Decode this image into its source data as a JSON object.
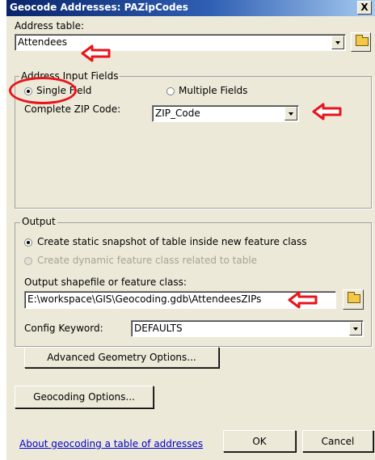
{
  "title": "Geocode Addresses: PAZipCodes",
  "close_label": "X",
  "address_table": {
    "label": "Address table:",
    "value": "Attendees"
  },
  "address_input_fields": {
    "legend": "Address Input Fields",
    "single_field_label": "Single Field",
    "multiple_fields_label": "Multiple Fields",
    "zip_label": "Complete ZIP Code:",
    "zip_value": "ZIP_Code"
  },
  "output": {
    "legend": "Output",
    "static_option": "Create static snapshot of table inside new feature class",
    "dynamic_option": "Create dynamic feature class related to table",
    "shapefile_label": "Output shapefile or feature class:",
    "shapefile_value": "E:\\workspace\\GIS\\Geocoding.gdb\\AttendeesZIPs",
    "config_keyword_label": "Config Keyword:",
    "config_keyword_value": "DEFAULTS",
    "advanced_button": "Advanced Geometry Options..."
  },
  "geocoding_options_button": "Geocoding Options...",
  "help_link": "About geocoding a table of addresses",
  "ok_button": "OK",
  "cancel_button": "Cancel",
  "annotation_color": "#e8141b",
  "icons": [
    "folder-open-icon",
    "dropdown-arrow-icon",
    "red-arrow-annotation",
    "red-ellipse-annotation"
  ]
}
